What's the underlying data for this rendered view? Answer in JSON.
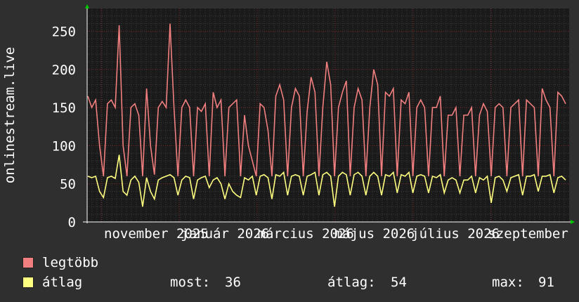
{
  "chart_data": {
    "type": "line",
    "ylabel": "onlinestream.live",
    "ylim": [
      0,
      280
    ],
    "yticks": [
      0,
      50,
      100,
      150,
      200,
      250
    ],
    "x_tick_labels": [
      "november 2025",
      "január 2026",
      "március 2026",
      "május 2026",
      "július 2026",
      "szeptember"
    ],
    "grid": true,
    "series": [
      {
        "name": "legtöbb",
        "color": "#f27f7f",
        "values": [
          165,
          150,
          160,
          100,
          60,
          155,
          160,
          150,
          258,
          100,
          60,
          150,
          155,
          140,
          60,
          175,
          100,
          62,
          150,
          158,
          150,
          260,
          150,
          60,
          150,
          160,
          150,
          60,
          150,
          145,
          155,
          60,
          170,
          150,
          160,
          60,
          150,
          155,
          160,
          60,
          140,
          100,
          80,
          60,
          155,
          150,
          120,
          60,
          165,
          180,
          160,
          60,
          150,
          175,
          165,
          60,
          145,
          190,
          170,
          60,
          150,
          210,
          180,
          60,
          150,
          170,
          185,
          60,
          150,
          175,
          160,
          60,
          150,
          200,
          180,
          60,
          170,
          165,
          175,
          60,
          160,
          155,
          170,
          60,
          150,
          160,
          150,
          60,
          150,
          150,
          165,
          60,
          140,
          140,
          150,
          60,
          140,
          140,
          150,
          60,
          140,
          155,
          145,
          60,
          150,
          155,
          150,
          60,
          150,
          155,
          160,
          60,
          160,
          155,
          150,
          60,
          175,
          160,
          150,
          60,
          170,
          165,
          155
        ],
        "range": [
          55,
          265
        ]
      },
      {
        "name": "átlag",
        "color": "#ffff80",
        "values": [
          60,
          58,
          60,
          40,
          32,
          58,
          60,
          57,
          88,
          40,
          35,
          55,
          60,
          52,
          20,
          58,
          40,
          30,
          55,
          58,
          60,
          62,
          58,
          35,
          55,
          60,
          58,
          30,
          55,
          58,
          60,
          45,
          55,
          58,
          50,
          30,
          50,
          40,
          35,
          32,
          58,
          55,
          60,
          35,
          60,
          62,
          58,
          30,
          62,
          60,
          65,
          35,
          60,
          62,
          60,
          35,
          60,
          62,
          65,
          35,
          62,
          65,
          60,
          20,
          60,
          65,
          62,
          35,
          62,
          65,
          60,
          35,
          60,
          65,
          60,
          35,
          62,
          60,
          65,
          38,
          62,
          60,
          65,
          38,
          60,
          62,
          60,
          38,
          60,
          58,
          62,
          38,
          55,
          58,
          55,
          38,
          55,
          55,
          60,
          38,
          58,
          55,
          60,
          25,
          58,
          60,
          55,
          40,
          58,
          60,
          62,
          35,
          60,
          60,
          62,
          40,
          60,
          60,
          62,
          38,
          58,
          60,
          55
        ],
        "range": [
          18,
          91
        ]
      }
    ]
  },
  "legend": [
    {
      "label": "legtöbb",
      "color": "#f27f7f"
    },
    {
      "label": "átlag",
      "color": "#ffff80"
    }
  ],
  "stats": {
    "now_label": "most:",
    "now_value": "36",
    "avg_label": "átlag:",
    "avg_value": "54",
    "max_label": "max:",
    "max_value": "91"
  },
  "colors": {
    "background": "#2f2f2f",
    "plot_background": "#1a1a1a",
    "grid_minor": "#3a3a3a",
    "grid_major": "#7a2c2c",
    "axis": "#ffffff",
    "arrow": "#00cc00"
  }
}
